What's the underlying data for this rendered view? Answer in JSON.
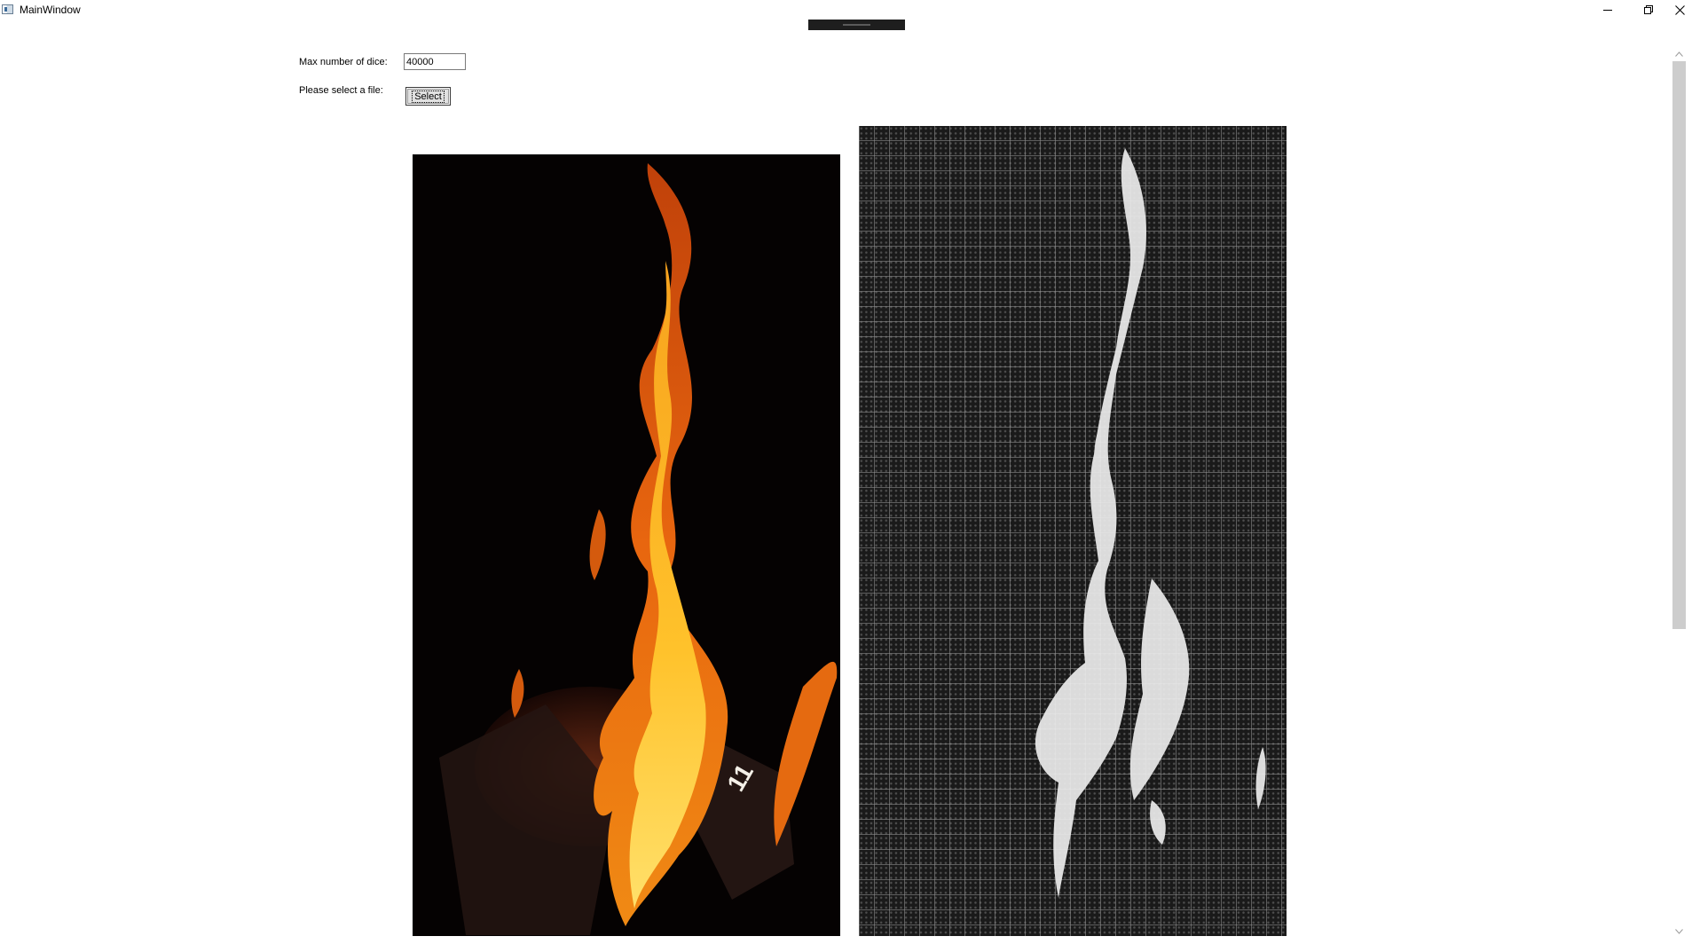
{
  "window": {
    "title": "MainWindow",
    "icon": "window-app-icon"
  },
  "caption_buttons": {
    "minimize_icon": "minimize-icon",
    "restore_icon": "restore-icon",
    "close_icon": "close-icon"
  },
  "controls": {
    "max_dice_label": "Max number of dice:",
    "max_dice_value": "40000",
    "file_label": "Please select a file:",
    "select_button_label": "Select"
  },
  "images": {
    "original": "flame-photo",
    "dice": "dice-rendered-image"
  },
  "scrollbar": {
    "up_icon": "chevron-up-icon",
    "down_icon": "chevron-down-icon"
  }
}
